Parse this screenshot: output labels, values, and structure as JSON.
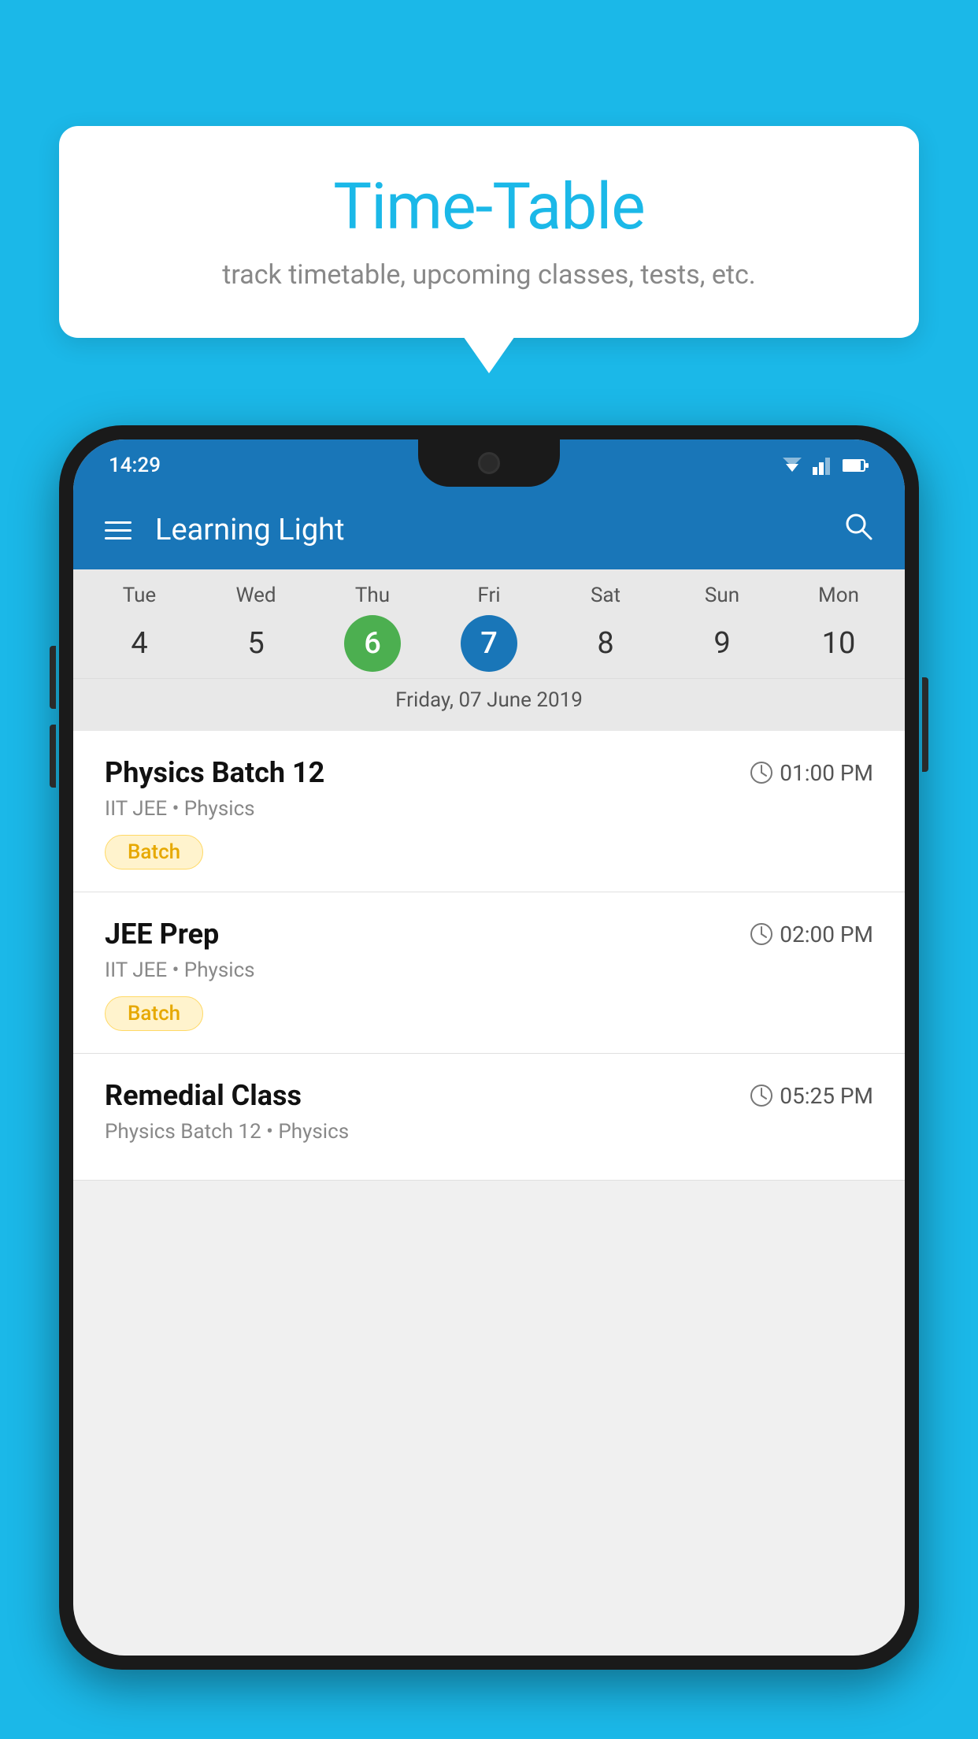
{
  "background_color": "#1BB8E8",
  "bubble": {
    "title": "Time-Table",
    "subtitle": "track timetable, upcoming classes, tests, etc."
  },
  "phone": {
    "status_bar": {
      "time": "14:29"
    },
    "app_bar": {
      "title": "Learning Light"
    },
    "calendar": {
      "days": [
        {
          "name": "Tue",
          "num": "4",
          "state": "normal"
        },
        {
          "name": "Wed",
          "num": "5",
          "state": "normal"
        },
        {
          "name": "Thu",
          "num": "6",
          "state": "today"
        },
        {
          "name": "Fri",
          "num": "7",
          "state": "selected"
        },
        {
          "name": "Sat",
          "num": "8",
          "state": "normal"
        },
        {
          "name": "Sun",
          "num": "9",
          "state": "normal"
        },
        {
          "name": "Mon",
          "num": "10",
          "state": "normal"
        }
      ],
      "selected_date_label": "Friday, 07 June 2019"
    },
    "classes": [
      {
        "name": "Physics Batch 12",
        "time": "01:00 PM",
        "subtitle": "IIT JEE • Physics",
        "badge": "Batch"
      },
      {
        "name": "JEE Prep",
        "time": "02:00 PM",
        "subtitle": "IIT JEE • Physics",
        "badge": "Batch"
      },
      {
        "name": "Remedial Class",
        "time": "05:25 PM",
        "subtitle": "Physics Batch 12 • Physics",
        "badge": null
      }
    ]
  }
}
